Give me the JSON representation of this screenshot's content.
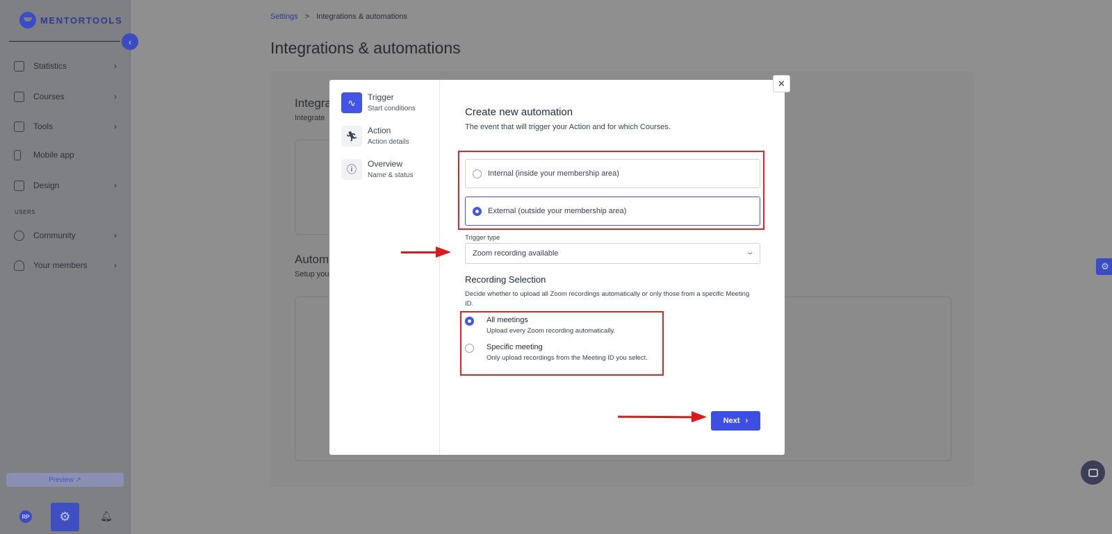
{
  "sidebar": {
    "logo": "MENTORTOOLS",
    "nav": [
      {
        "label": "Statistics",
        "icon": "bar-chart-icon",
        "has_chevron": true
      },
      {
        "label": "Courses",
        "icon": "book-icon",
        "has_chevron": true
      },
      {
        "label": "Tools",
        "icon": "megaphone-icon",
        "has_chevron": true
      },
      {
        "label": "Mobile app",
        "icon": "phone-icon",
        "has_chevron": false
      },
      {
        "label": "Design",
        "icon": "pencil-icon",
        "has_chevron": true
      }
    ],
    "section_users": "USERS",
    "nav_users": [
      {
        "label": "Community",
        "icon": "people-icon",
        "has_chevron": true
      },
      {
        "label": "Your members",
        "icon": "user-icon",
        "has_chevron": true
      }
    ],
    "preview_label": "Preview ↗",
    "avatar_initials": "RP"
  },
  "breadcrumb": {
    "link": "Settings",
    "separator": ">",
    "current": "Integrations & automations"
  },
  "page": {
    "title": "Integrations & automations",
    "section1_title_partial": "Integra",
    "section1_sub_partial": "Integrate",
    "section2_title_partial": "Autom",
    "section2_sub_partial": "Setup you"
  },
  "modal": {
    "steps": [
      {
        "title": "Trigger",
        "subtitle": "Start conditions",
        "icon": "activity-icon",
        "active": true
      },
      {
        "title": "Action",
        "subtitle": "Action details",
        "icon": "running-icon",
        "active": false
      },
      {
        "title": "Overview",
        "subtitle": "Name & status",
        "icon": "info-icon",
        "active": false
      }
    ],
    "title": "Create new automation",
    "subtitle": "The event that will trigger your Action and for which Courses.",
    "options": [
      {
        "label": "Internal (inside your membership area)",
        "selected": false
      },
      {
        "label": "External (outside your membership area)",
        "selected": true
      }
    ],
    "trigger_type_label": "Trigger type",
    "trigger_type_value": "Zoom recording available",
    "recording": {
      "title": "Recording Selection",
      "description": "Decide whether to upload all Zoom recordings automatically or only those from a specific Meeting ID.",
      "options": [
        {
          "title": "All meetings",
          "subtitle": "Upload every Zoom recording automatically.",
          "selected": true
        },
        {
          "title": "Specific meeting",
          "subtitle": "Only upload recordings from the Meeting ID you select.",
          "selected": false
        }
      ]
    },
    "next_label": "Next",
    "close_glyph": "✕"
  },
  "colors": {
    "accent": "#4355e8",
    "annotation_red": "#e02424",
    "overlay": "#8f8f8f"
  }
}
